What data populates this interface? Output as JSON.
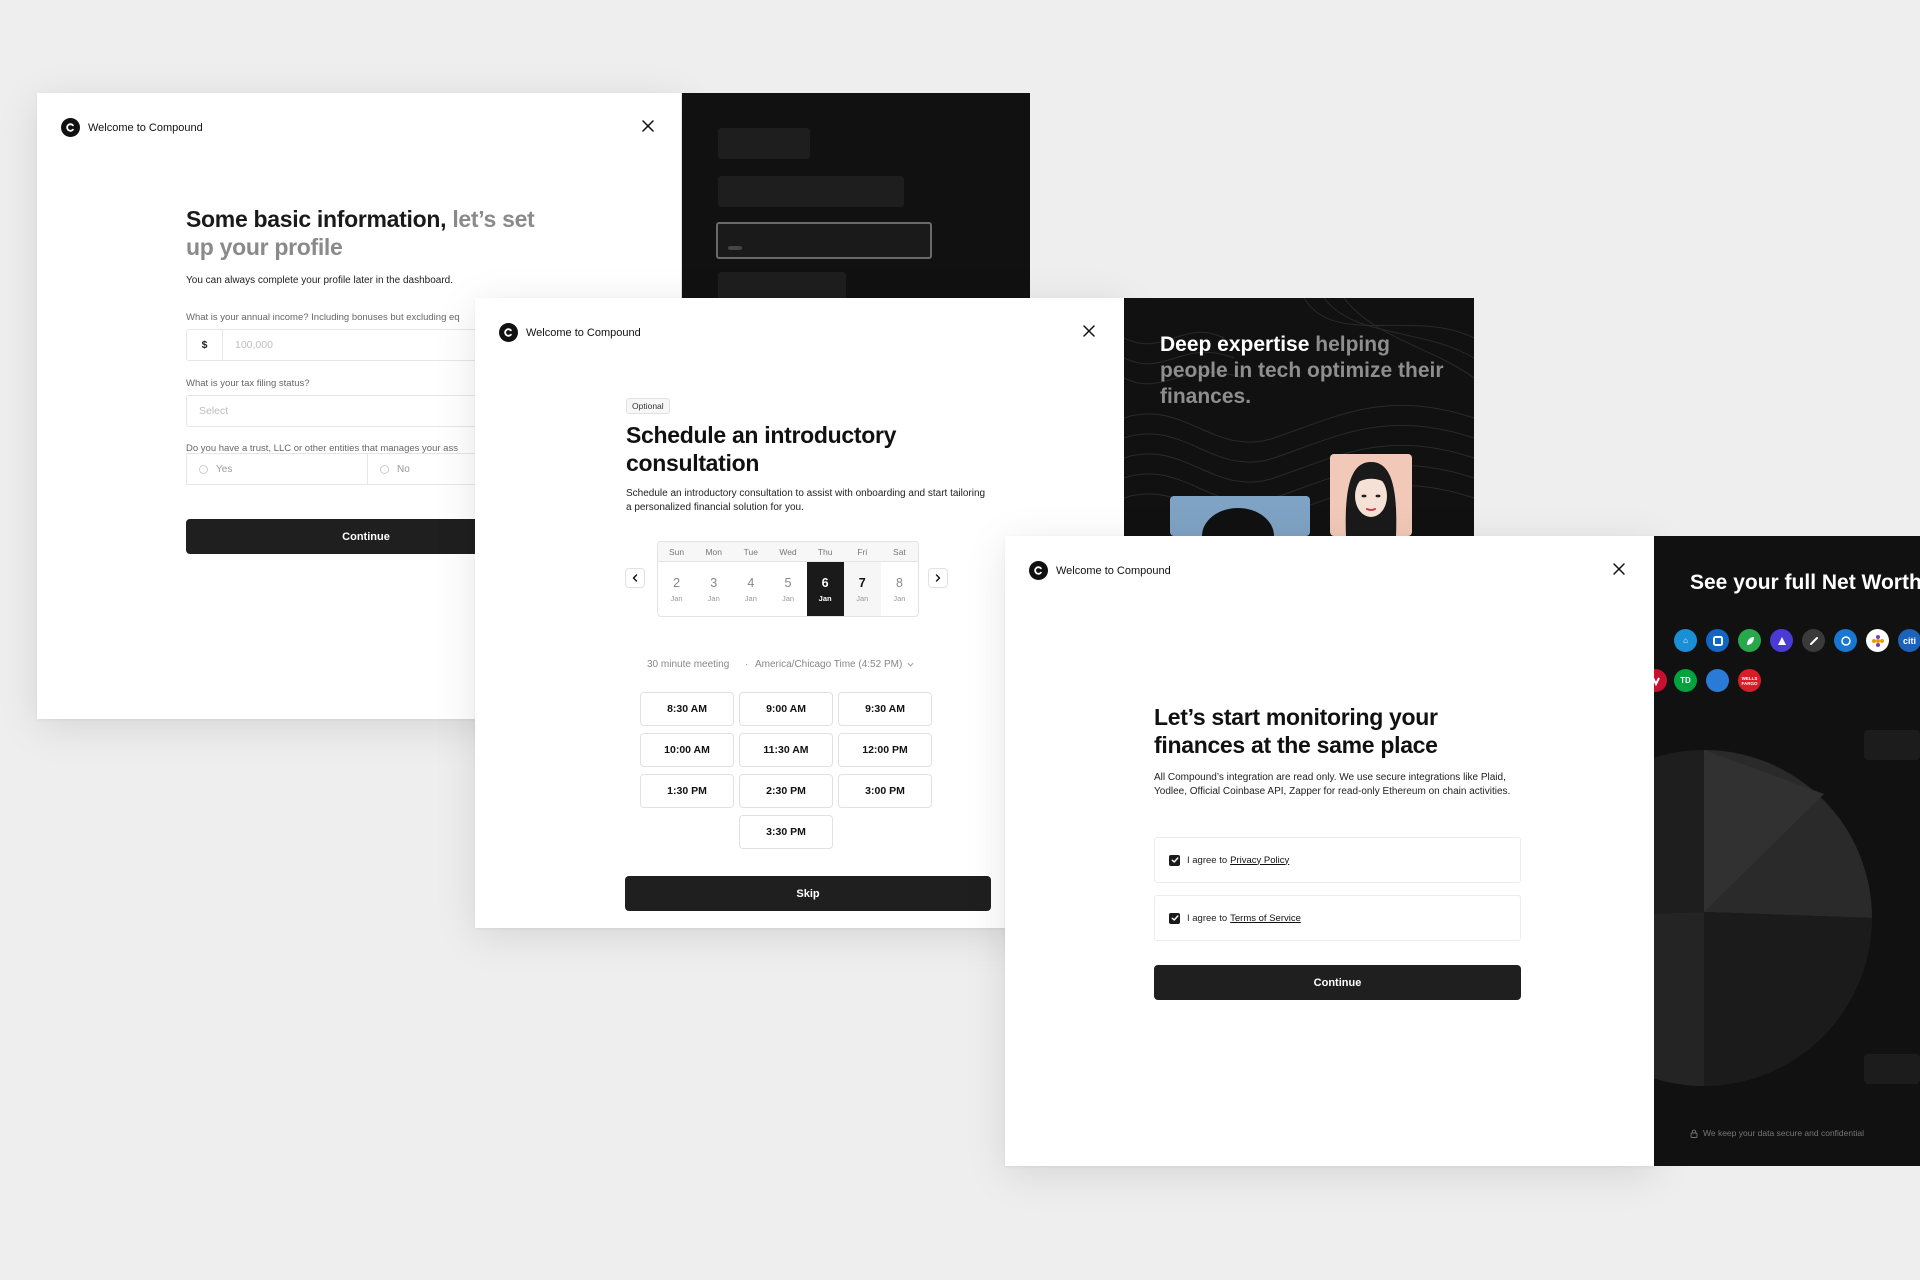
{
  "brand": {
    "name": "Welcome to Compound"
  },
  "profile": {
    "title_main": "Some basic information,",
    "title_muted": "let’s set up your profile",
    "subtitle": "You can always complete your profile later in the dashboard.",
    "income_label": "What is your annual income? Including bonuses but excluding eq",
    "income_prefix": "$",
    "income_placeholder": "100,000",
    "tax_label": "What is your tax filing status?",
    "tax_placeholder": "Select",
    "trust_label": "Do you have a trust, LLC or other entities that manages your ass",
    "trust_yes": "Yes",
    "trust_no": "No",
    "continue_label": "Continue"
  },
  "schedule": {
    "optional_tag": "Optional",
    "title": "Schedule an introductory consultation",
    "description": "Schedule an introductory consultation to assist with onboarding and start tailoring a personalized financial solution for you.",
    "weekdays": [
      "Sun",
      "Mon",
      "Tue",
      "Wed",
      "Thu",
      "Fri",
      "Sat"
    ],
    "days": [
      {
        "num": "2",
        "month": "Jan"
      },
      {
        "num": "3",
        "month": "Jan"
      },
      {
        "num": "4",
        "month": "Jan"
      },
      {
        "num": "5",
        "month": "Jan"
      },
      {
        "num": "6",
        "month": "Jan"
      },
      {
        "num": "7",
        "month": "Jan"
      },
      {
        "num": "8",
        "month": "Jan"
      }
    ],
    "selected_day": "6",
    "meeting_length": "30 minute meeting",
    "timezone": "America/Chicago Time (4:52 PM)",
    "slots": [
      "8:30 AM",
      "9:00 AM",
      "9:30 AM",
      "10:00 AM",
      "11:30 AM",
      "12:00 PM",
      "1:30 PM",
      "2:30 PM",
      "3:00 PM",
      "3:30 PM"
    ],
    "skip_label": "Skip"
  },
  "expertise": {
    "highlight": "Deep expertise",
    "rest": "helping people in tech optimize their finances."
  },
  "monitoring": {
    "title": "Let’s start monitoring your finances at the same place",
    "description": "All Compound’s integration are read only. We use secure integrations like Plaid, Yodlee, Official Coinbase API, Zapper for read-only Ethereum on chain activities.",
    "privacy_prefix": "I agree to",
    "privacy_link": "Privacy Policy",
    "terms_prefix": "I agree to",
    "terms_link": "Terms of Service",
    "continue_label": "Continue"
  },
  "networth": {
    "title": "See your full Net Worth",
    "secure_note": "We keep your data secure and confidential",
    "logo_text": {
      "citi": "citi",
      "td": "TD",
      "wells": "WELLS FARGO"
    }
  },
  "colors": {
    "dark_panel": "#111111",
    "button": "#1f1f1f",
    "background": "#eeeeee"
  }
}
